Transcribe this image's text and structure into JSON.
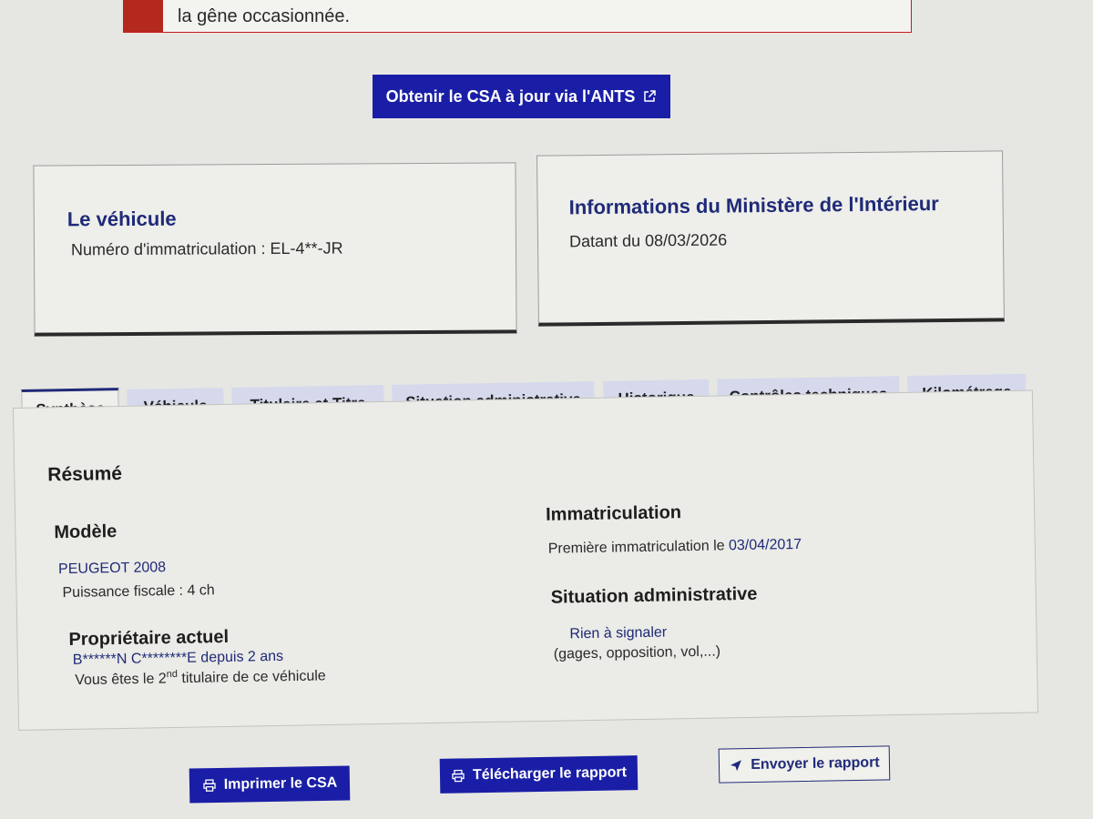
{
  "alert": {
    "text": "la gêne occasionnée."
  },
  "csa_button": {
    "label": "Obtenir le CSA à jour via l'ANTS",
    "icon": "external-link-icon"
  },
  "vehicle_card": {
    "title": "Le véhicule",
    "plate_label": "Numéro d'immatriculation : ",
    "plate_value": "EL-4**-JR"
  },
  "ministry_card": {
    "title": "Informations du Ministère de l'Intérieur",
    "date_line": "Datant du 08/03/2026"
  },
  "tabs": [
    {
      "label": "Synthèse",
      "active": true
    },
    {
      "label": "Véhicule",
      "active": false
    },
    {
      "label": "Titulaire et Titre",
      "active": false
    },
    {
      "label": "Situation administrative",
      "active": false
    },
    {
      "label": "Historique",
      "active": false
    },
    {
      "label": "Contrôles techniques",
      "active": false
    },
    {
      "label": "Kilométrage",
      "active": false
    }
  ],
  "summary": {
    "title": "Résumé",
    "model": {
      "heading": "Modèle",
      "name": "PEUGEOT 2008",
      "power": "Puissance fiscale : 4 ch"
    },
    "owner": {
      "heading": "Propriétaire actuel",
      "name": "B******N C********E",
      "since": " depuis 2 ans",
      "rank_prefix": "Vous êtes le 2",
      "rank_sup": "nd",
      "rank_suffix": " titulaire de ce véhicule"
    },
    "registration": {
      "heading": "Immatriculation",
      "first_label": "Première immatriculation le ",
      "first_date": "03/04/2017"
    },
    "admin": {
      "heading": "Situation administrative",
      "status": "Rien à signaler",
      "detail": "(gages, opposition, vol,...)"
    }
  },
  "actions": {
    "print_label": "Imprimer le CSA",
    "download_label": "Télécharger le rapport",
    "send_label": "Envoyer le rapport",
    "print_icon": "printer-icon",
    "send_icon": "send-icon"
  },
  "colors": {
    "primary": "#1a1ea6",
    "navy_text": "#1f2a78",
    "alert_red": "#b5281d",
    "tab_bg": "#d6d9ec"
  }
}
